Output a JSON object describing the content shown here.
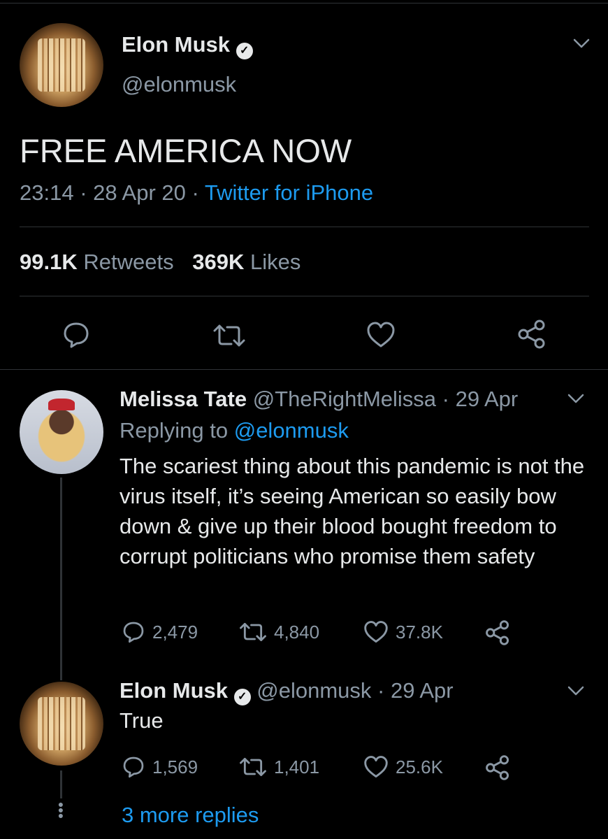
{
  "main_tweet": {
    "author_name": "Elon Musk",
    "handle": "@elonmusk",
    "text": "FREE AMERICA NOW",
    "time": "23:14",
    "date": "28 Apr 20",
    "source": "Twitter for iPhone",
    "retweets_count": "99.1K",
    "retweets_label": "Retweets",
    "likes_count": "369K",
    "likes_label": "Likes"
  },
  "replies": [
    {
      "author_name": "Melissa Tate",
      "handle": "@TheRightMelissa",
      "date": "29 Apr",
      "replying_prefix": "Replying to",
      "replying_to": "@elonmusk",
      "text": "The scariest thing about this pandemic is not the virus itself, it’s seeing American so easily bow down & give up their blood bought freedom to corrupt politicians who promise them safety",
      "replies_count": "2,479",
      "retweets_count": "4,840",
      "likes_count": "37.8K"
    },
    {
      "author_name": "Elon Musk",
      "handle": "@elonmusk",
      "date": "29 Apr",
      "text": "True",
      "replies_count": "1,569",
      "retweets_count": "1,401",
      "likes_count": "25.6K"
    }
  ],
  "more_replies": "3 more replies",
  "separator_dot": "·",
  "verified_mark": "✓",
  "icons": [
    "chevron-down-icon",
    "reply-icon",
    "retweet-icon",
    "like-icon",
    "share-icon",
    "verified-icon"
  ],
  "colors": {
    "background": "#000000",
    "text": "#e7e9ea",
    "muted": "#8b98a5",
    "link": "#1d9bf0",
    "divider": "#2f3336"
  }
}
